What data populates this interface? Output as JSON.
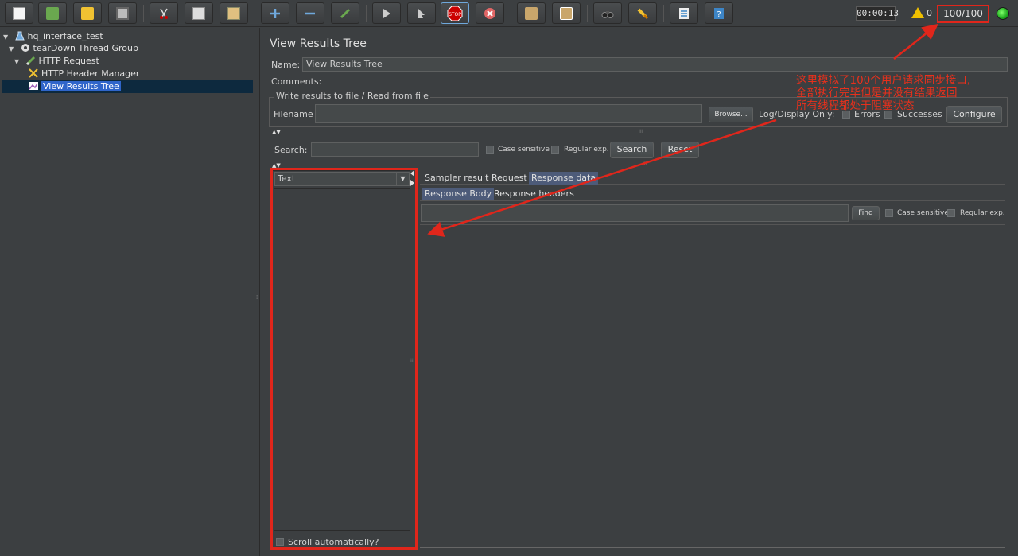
{
  "toolbar": {
    "buttons": [
      {
        "name": "new-icon",
        "color": "#ffffff"
      },
      {
        "name": "templates-icon",
        "color": "#6aa84f"
      },
      {
        "name": "open-icon",
        "color": "#f1c232"
      },
      {
        "name": "save-icon",
        "color": "#cccccc"
      },
      {
        "name": "cut-icon",
        "color": "#cc0000"
      },
      {
        "name": "copy-icon",
        "color": "#dddddd"
      },
      {
        "name": "paste-icon",
        "color": "#e0c080"
      },
      {
        "name": "expand-icon",
        "color": "#6fa8dc"
      },
      {
        "name": "collapse-icon",
        "color": "#6fa8dc"
      },
      {
        "name": "toggle-icon",
        "color": "#6aa84f"
      },
      {
        "name": "start-icon",
        "color": "#cccccc"
      },
      {
        "name": "start-no-pauses-icon",
        "color": "#cccccc"
      },
      {
        "name": "stop-icon",
        "color": "#cc0000"
      },
      {
        "name": "shutdown-icon",
        "color": "#e06666"
      },
      {
        "name": "clear-icon",
        "color": "#c9a66b"
      },
      {
        "name": "clear-all-icon",
        "color": "#c9a66b"
      },
      {
        "name": "search-binoculars-icon",
        "color": "#888888"
      },
      {
        "name": "reset-search-icon",
        "color": "#f1c232"
      },
      {
        "name": "function-helper-icon",
        "color": "#6fa8dc"
      },
      {
        "name": "help-icon",
        "color": "#3d85c6"
      }
    ],
    "stop_label": "STOP",
    "timer": "00:00:13",
    "warning_count": "0",
    "threads": "100/100"
  },
  "tree": {
    "items": [
      {
        "label": "hq_interface_test",
        "icon": "test-plan-icon"
      },
      {
        "label": "tearDown Thread Group",
        "icon": "gear-icon"
      },
      {
        "label": "HTTP Request",
        "icon": "sampler-pencil-icon"
      },
      {
        "label": "HTTP Header Manager",
        "icon": "tools-icon"
      },
      {
        "label": "View Results Tree",
        "icon": "listener-chart-icon"
      }
    ]
  },
  "panel": {
    "title": "View Results Tree",
    "name_label": "Name:",
    "name_value": "View Results Tree",
    "comments_label": "Comments:",
    "group_title": "Write results to file / Read from file",
    "filename_label": "Filename",
    "browse_label": "Browse...",
    "log_display_label": "Log/Display Only:",
    "errors_label": "Errors",
    "successes_label": "Successes",
    "configure_label": "Configure",
    "search_label": "Search:",
    "case_sensitive_label": "Case sensitive",
    "regular_exp_label": "Regular exp.",
    "search_button": "Search",
    "reset_button": "Reset",
    "renderer_value": "Text",
    "scroll_label": "Scroll automatically?",
    "tabs": [
      "Sampler result",
      "Request",
      "Response data"
    ],
    "subtabs": [
      "Response Body",
      "Response headers"
    ],
    "find_button": "Find",
    "find_case_label": "Case sensitive",
    "find_regexp_label": "Regular exp."
  },
  "annotation": {
    "lines": [
      "这里模拟了100个用户请求同步接口,",
      "全部执行完毕但是并没有结果返回",
      "所有线程都处于阻塞状态"
    ],
    "color": "#e8301c"
  }
}
